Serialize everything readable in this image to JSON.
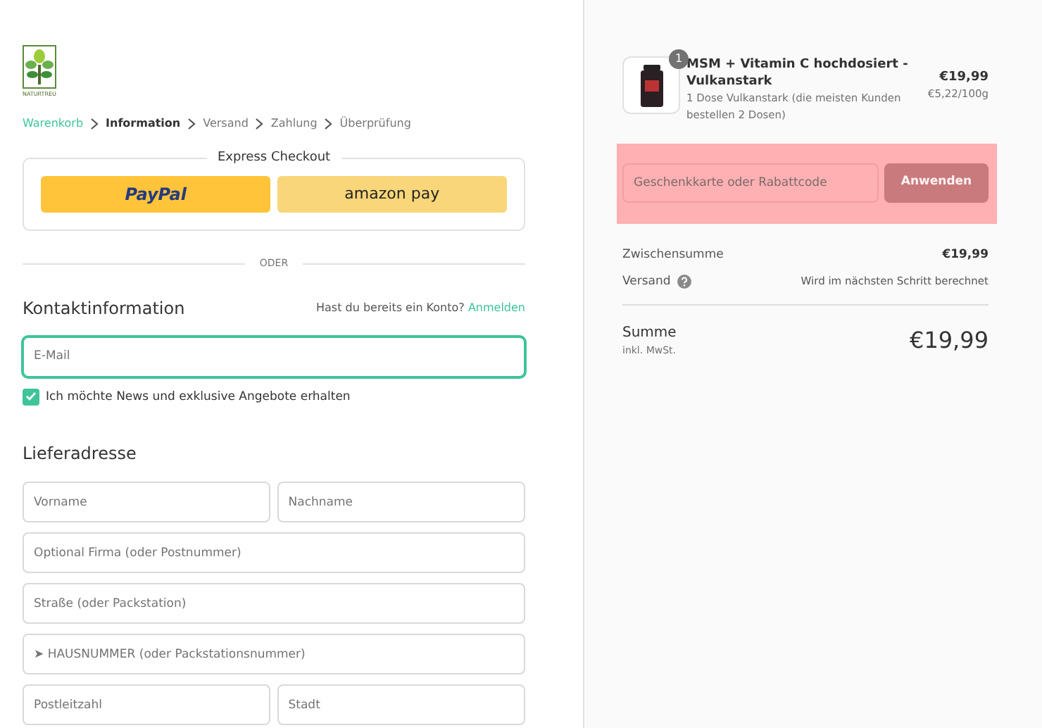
{
  "logo": {
    "text": "NATURTREU"
  },
  "breadcrumb": [
    {
      "label": "Warenkorb",
      "kind": "link",
      "selected": false
    },
    {
      "label": "Information",
      "kind": "step",
      "selected": true
    },
    {
      "label": "Versand",
      "kind": "step",
      "selected": false
    },
    {
      "label": "Zahlung",
      "kind": "step",
      "selected": false
    },
    {
      "label": "Überprüfung",
      "kind": "step",
      "selected": false
    }
  ],
  "express_checkout": {
    "title": "Express Checkout",
    "buttons": [
      {
        "kind": "paypal",
        "label": "PayPal"
      },
      {
        "kind": "amazon",
        "label": "amazon pay"
      }
    ]
  },
  "divider": "ODER",
  "contact": {
    "title": "Kontaktinformation",
    "account_prompt": "Hast du bereits ein Konto?",
    "login_link": "Anmelden",
    "email": {
      "placeholder": "E-Mail",
      "focused": true
    },
    "newsletter": {
      "label": "Ich möchte News und exklusive Angebote erhalten",
      "checked": true
    }
  },
  "shipping": {
    "title": "Lieferadresse",
    "rows": [
      {
        "fields": [
          {
            "placeholder": "Vorname"
          },
          {
            "placeholder": "Nachname"
          }
        ]
      },
      {
        "fields": [
          {
            "placeholder": "Optional Firma (oder Postnummer)"
          }
        ]
      },
      {
        "fields": [
          {
            "placeholder": "Straße (oder Packstation)"
          }
        ]
      },
      {
        "fields": [
          {
            "placeholder": "➤ HAUSNUMMER (oder Packstationsnummer)"
          }
        ]
      },
      {
        "fields": [
          {
            "placeholder": "Postleitzahl"
          },
          {
            "placeholder": "Stadt"
          }
        ]
      }
    ]
  },
  "order": {
    "items": [
      {
        "quantity": "1",
        "title": "MSM + Vitamin C hochdosiert - Vulkanstark",
        "variant": "1 Dose Vulkanstark (die meisten Kunden bestellen 2 Dosen)",
        "price": "€19,99",
        "unit_price": "€5,22/100g"
      }
    ],
    "discount": {
      "highlighted": true,
      "placeholder": "Geschenkkarte oder Rabattcode",
      "button": "Anwenden"
    },
    "subtotal": {
      "label": "Zwischensumme",
      "value": "€19,99"
    },
    "shipping": {
      "label": "Versand",
      "value": "Wird im nächsten Schritt berechnet"
    },
    "total": {
      "label": "Summe",
      "note": "inkl. MwSt.",
      "value": "€19,99"
    }
  }
}
